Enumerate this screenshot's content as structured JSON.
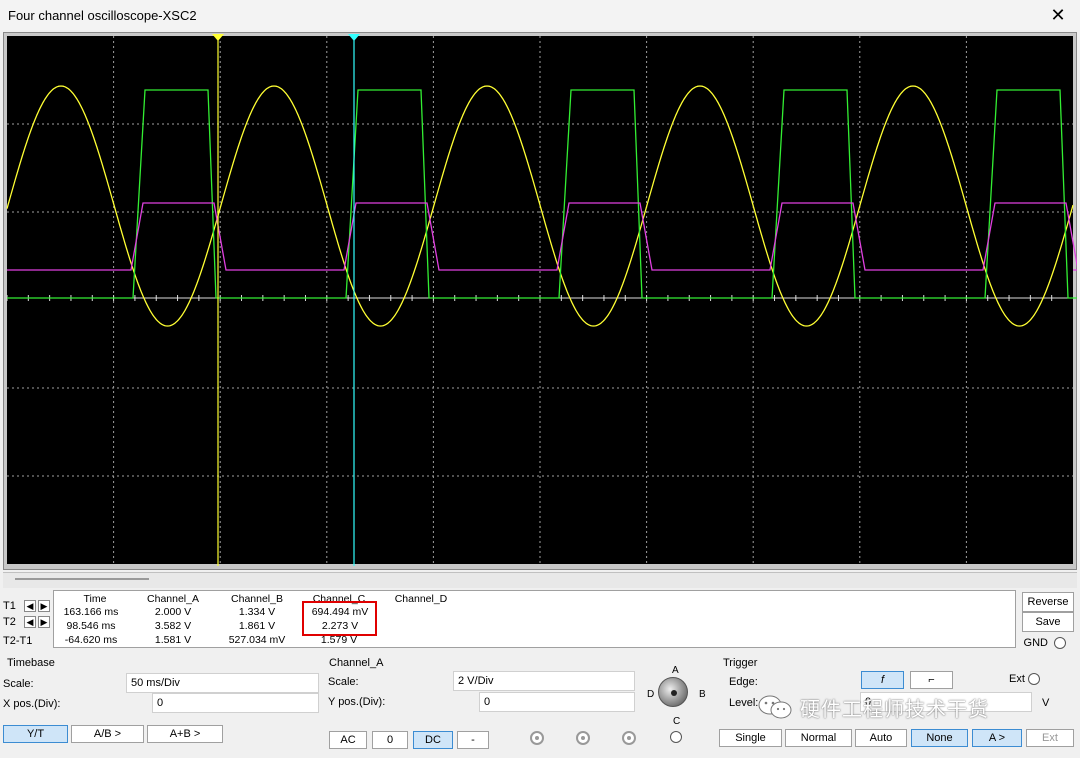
{
  "window": {
    "title": "Four channel oscilloscope-XSC2",
    "close": "✕"
  },
  "colors": {
    "channel_a": "#ffff33",
    "channel_b": "#33ee33",
    "channel_c": "#e040e0",
    "cursor_t1": "#ffff33",
    "cursor_t2": "#33ffff",
    "grid": "#a0a0a0",
    "screen_bg": "#000000"
  },
  "readout": {
    "headers": [
      "Time",
      "Channel_A",
      "Channel_B",
      "Channel_C",
      "Channel_D"
    ],
    "rows": [
      {
        "label": "T1",
        "time": "163.166 ms",
        "a": "2.000 V",
        "b": "1.334 V",
        "c": "694.494 mV",
        "d": ""
      },
      {
        "label": "T2",
        "time": "98.546 ms",
        "a": "3.582 V",
        "b": "1.861 V",
        "c": "2.273 V",
        "d": ""
      },
      {
        "label": "T2-T1",
        "time": "-64.620 ms",
        "a": "1.581 V",
        "b": "527.034 mV",
        "c": "1.579 V",
        "d": ""
      }
    ]
  },
  "right": {
    "reverse": "Reverse",
    "save": "Save",
    "gnd": "GND"
  },
  "timebase": {
    "group": "Timebase",
    "scale_label": "Scale:",
    "scale_value": "50 ms/Div",
    "xpos_label": "X pos.(Div):",
    "xpos_value": "0",
    "modes": [
      "Y/T",
      "A/B >",
      "A+B >"
    ]
  },
  "channel": {
    "group": "Channel_A",
    "scale_label": "Scale:",
    "scale_value": "2  V/Div",
    "ypos_label": "Y pos.(Div):",
    "ypos_value": "0",
    "coupling": [
      "AC",
      "0",
      "DC",
      "-"
    ],
    "knob_labels": [
      "A",
      "B",
      "C",
      "D"
    ]
  },
  "trigger": {
    "group": "Trigger",
    "edge_label": "Edge:",
    "edge_rising": "f",
    "edge_falling": "⌐",
    "ext": "Ext",
    "level_label": "Level:",
    "level_value": "0",
    "level_unit": "V",
    "modes": [
      "Single",
      "Normal",
      "Auto",
      "None",
      "A >",
      "Ext"
    ]
  },
  "watermark": "硬件工程师技术干货"
}
